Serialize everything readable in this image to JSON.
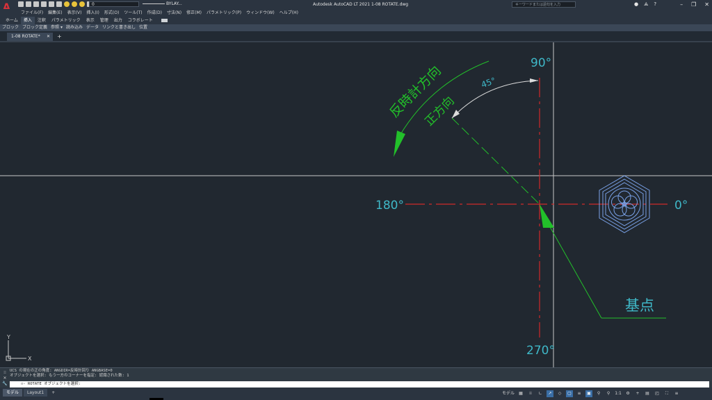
{
  "window": {
    "title": "Autodesk AutoCAD LT 2021    1-08 ROTATE.dwg",
    "app_logo": "A",
    "search_placeholder": "キーワードまたは語句を入力",
    "layer_current": "0",
    "linetype": "BYLAY..."
  },
  "menu": [
    "ファイル(F)",
    "編集(E)",
    "表示(V)",
    "挿入(I)",
    "形式(O)",
    "ツール(T)",
    "作成(D)",
    "寸法(N)",
    "修正(M)",
    "パラメトリック(P)",
    "ウィンドウ(W)",
    "ヘルプ(H)"
  ],
  "ribbon_tabs": [
    "ホーム",
    "挿入",
    "注釈",
    "パラメトリック",
    "表示",
    "管理",
    "出力",
    "コラボレート"
  ],
  "ribbon_active": "挿入",
  "ribbon_panels": [
    "ブロック",
    "ブロック定義",
    "参照 ▾",
    "読み込み",
    "データ",
    "リンクと書き出し",
    "位置"
  ],
  "file_tab": "1-08 ROTATE*",
  "drawing": {
    "label_0": "0°",
    "label_90": "90°",
    "label_180": "180°",
    "label_270": "270°",
    "angle_label": "45°",
    "ccw_label": "反時計方向",
    "positive_label": "正方向",
    "base_point_label": "基点",
    "ucs_y": "Y",
    "ucs_x": "X"
  },
  "colors": {
    "axis_red": "#d02a2a",
    "green": "#22c02a",
    "cyan": "#3fb8c8",
    "block_blue": "#7aa2e8",
    "crosshair": "#c8c8c8"
  },
  "command": {
    "history": [
      "UCS の現在の正の角度:  ANGDIR=反時計回り  ANGBASE=0",
      "オブジェクトを選択: もう一方のコーナーを指定: 認識された数: 1"
    ],
    "prompt": "▫- ROTATE オブジェクトを選択:"
  },
  "layout_tabs": [
    "モデル",
    "Layout1"
  ],
  "status": {
    "model": "モデル",
    "scale": "1:1"
  }
}
